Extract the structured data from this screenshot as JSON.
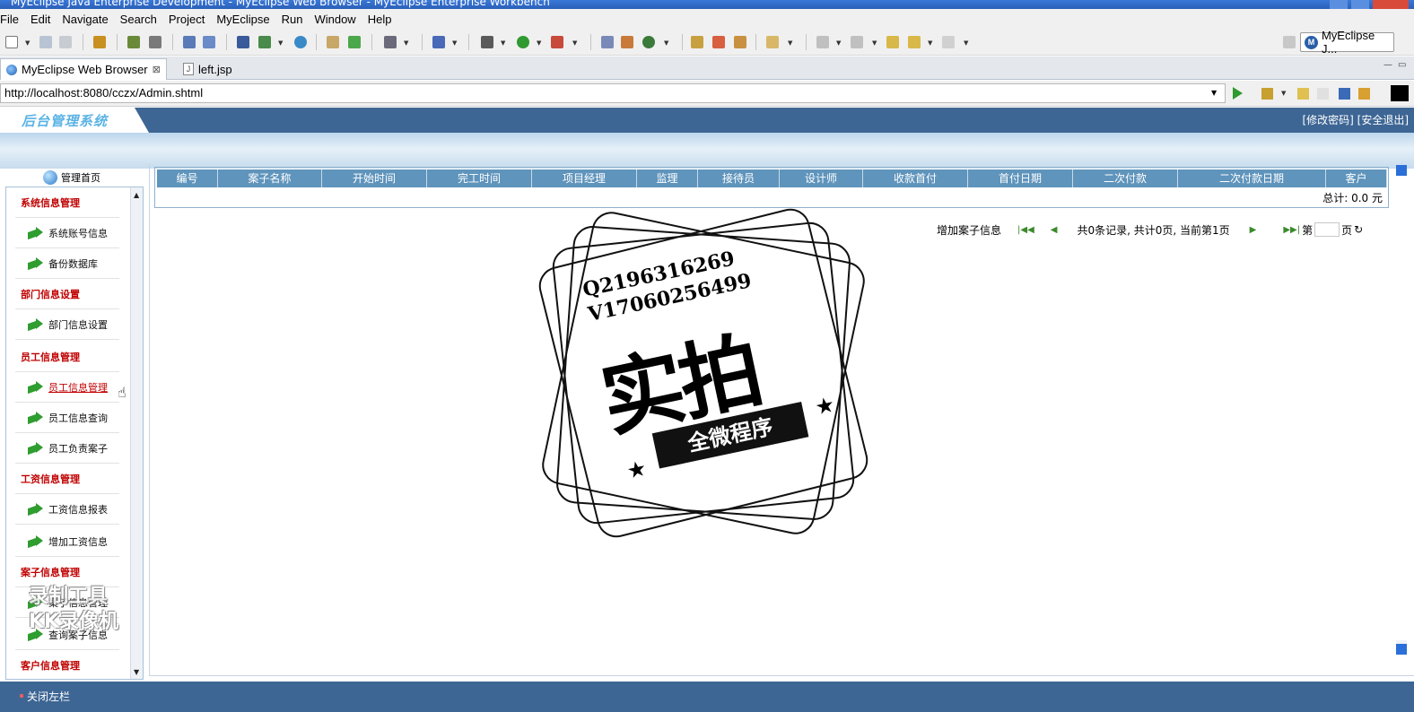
{
  "window": {
    "title": "MyEclipse Java Enterprise Development - MyEclipse Web Browser - MyEclipse Enterprise Workbench"
  },
  "menu": [
    "File",
    "Edit",
    "Navigate",
    "Search",
    "Project",
    "MyEclipse",
    "Run",
    "Window",
    "Help"
  ],
  "perspective": {
    "label": "MyEclipse J...",
    "badge": "M"
  },
  "tabs": [
    {
      "label": "MyEclipse Web Browser",
      "close": "⊠"
    },
    {
      "label": "left.jsp"
    }
  ],
  "address": {
    "url": "http://localhost:8080/cczx/Admin.shtml"
  },
  "webpage": {
    "logo": "后台管理系统",
    "header_links": "[修改密码] [安全退出]",
    "home_label": "管理首页",
    "sidebar": [
      {
        "type": "section",
        "label": "系统信息管理"
      },
      {
        "type": "link",
        "label": "系统账号信息"
      },
      {
        "type": "link",
        "label": "备份数据库"
      },
      {
        "type": "section",
        "label": "部门信息设置"
      },
      {
        "type": "link",
        "label": "部门信息设置"
      },
      {
        "type": "section",
        "label": "员工信息管理"
      },
      {
        "type": "link",
        "label": "员工信息管理",
        "hover": true
      },
      {
        "type": "link",
        "label": "员工信息查询"
      },
      {
        "type": "link",
        "label": "员工负责案子"
      },
      {
        "type": "section",
        "label": "工资信息管理"
      },
      {
        "type": "link",
        "label": "工资信息报表"
      },
      {
        "type": "link",
        "label": "增加工资信息"
      },
      {
        "type": "section",
        "label": "案子信息管理"
      },
      {
        "type": "link",
        "label": "案子信息管理"
      },
      {
        "type": "link",
        "label": "查询案子信息"
      },
      {
        "type": "section",
        "label": "客户信息管理"
      }
    ],
    "footer_label": "关闭左栏",
    "table": {
      "columns": [
        "编号",
        "案子名称",
        "开始时间",
        "完工时间",
        "项目经理",
        "监理",
        "接待员",
        "设计师",
        "收款首付",
        "首付日期",
        "二次付款",
        "二次付款日期",
        "客户"
      ],
      "total": "总计: 0.0  元"
    },
    "pager": {
      "add_link": "增加案子信息",
      "status": "共0条记录, 共计0页, 当前第1页",
      "page_prefix": "第",
      "page_suffix": "页"
    }
  },
  "watermark": {
    "qq": "Q2196316269",
    "wx": "V17060256499",
    "big": "实拍",
    "banner": "全微程序",
    "recorder_line1": "录制工具",
    "recorder_line2": "KK录像机"
  },
  "colors": {
    "header_blue": "#3d6694",
    "grid_header": "#5f94bc",
    "section_red": "#c00000"
  }
}
